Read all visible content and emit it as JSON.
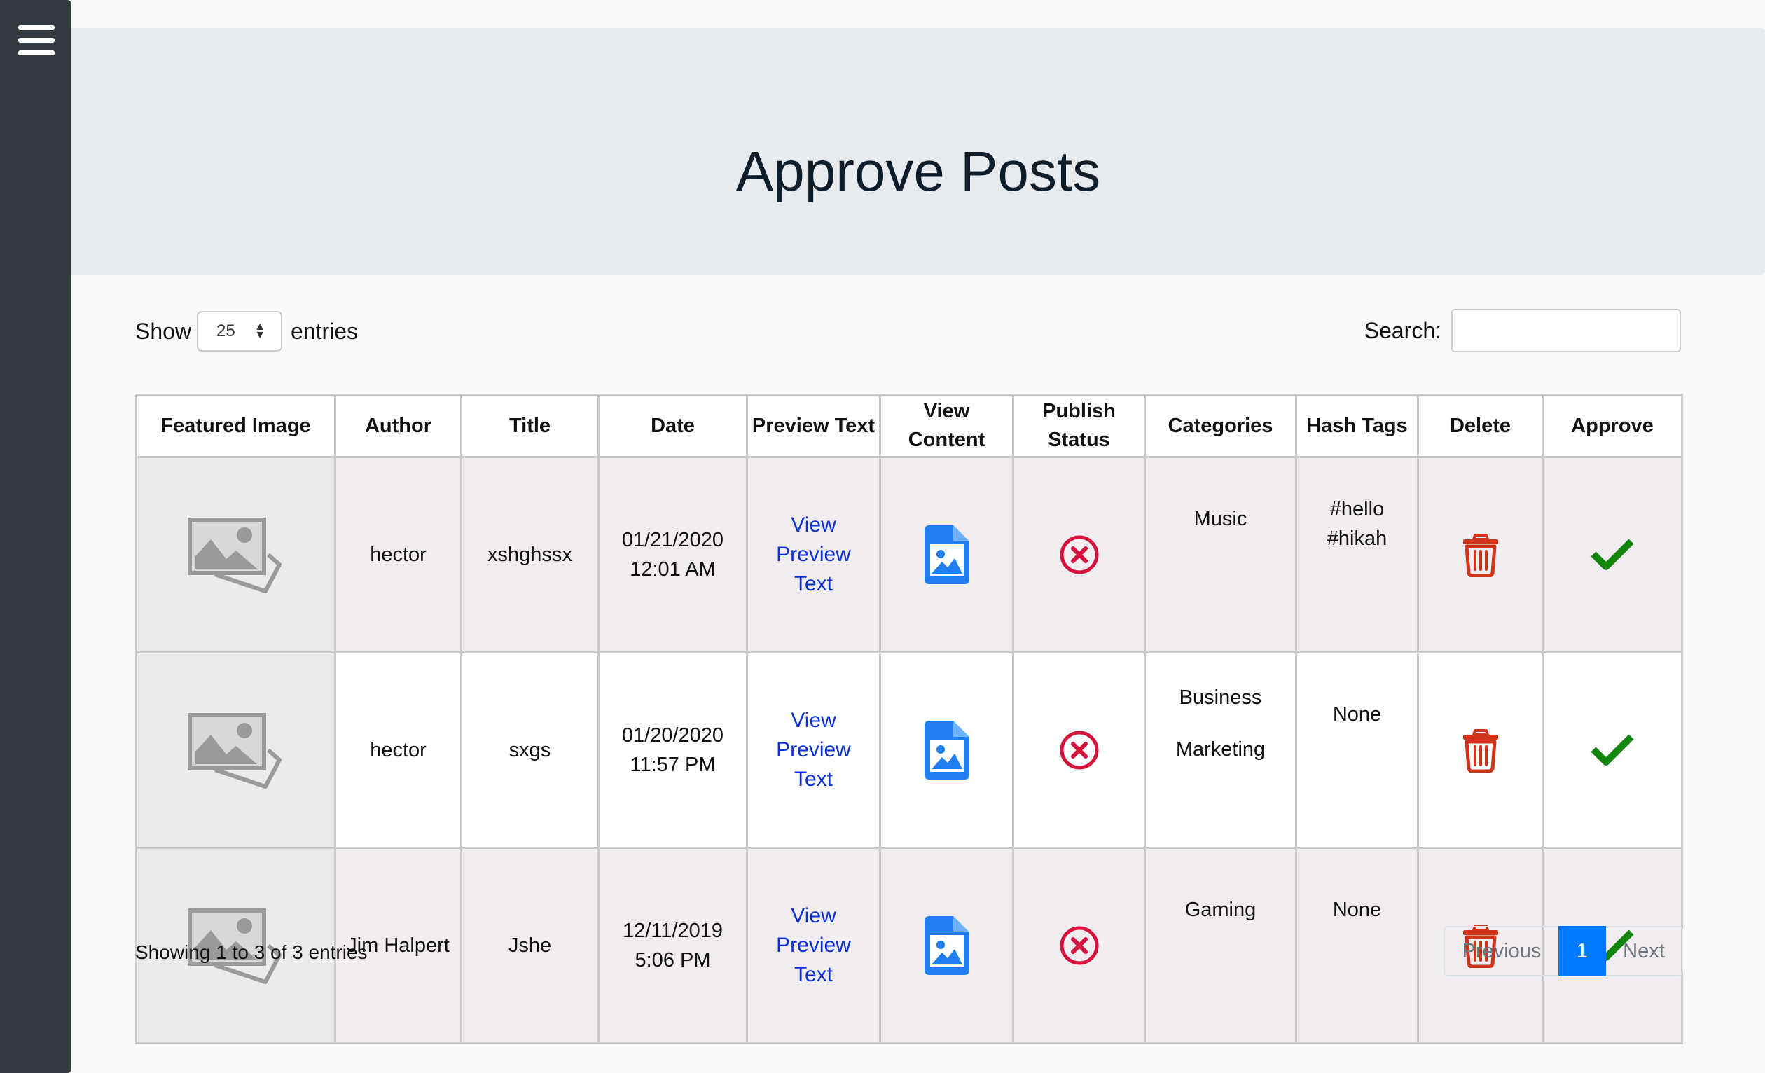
{
  "page": {
    "title": "Approve Posts"
  },
  "controls": {
    "show_label": "Show",
    "entries_label": "entries",
    "page_length": "25",
    "search_label": "Search:",
    "search_value": ""
  },
  "table": {
    "headers": {
      "featured_image": "Featured Image",
      "author": "Author",
      "title": "Title",
      "date": "Date",
      "preview_text": "Preview Text",
      "view_content": "View Content",
      "publish_status_1": "Publish",
      "publish_status_2": "Status",
      "categories": "Categories",
      "hash_tags": "Hash Tags",
      "delete": "Delete",
      "approve": "Approve"
    },
    "rows": [
      {
        "author": "hector",
        "title": "xshghssx",
        "date": "01/21/2020",
        "time": "12:01 AM",
        "preview_1": "View Preview",
        "preview_2": "Text",
        "categories": [
          "Music"
        ],
        "hashtags": [
          "#hello",
          "#hikah"
        ]
      },
      {
        "author": "hector",
        "title": "sxgs",
        "date": "01/20/2020",
        "time": "11:57 PM",
        "preview_1": "View Preview",
        "preview_2": "Text",
        "categories": [
          "Business",
          "Marketing"
        ],
        "hashtags": [
          "None"
        ]
      },
      {
        "author": "Jim Halpert",
        "title": "Jshe",
        "date": "12/11/2019",
        "time": "5:06 PM",
        "preview_1": "View Preview",
        "preview_2": "Text",
        "categories": [
          "Gaming"
        ],
        "hashtags": [
          "None"
        ]
      }
    ]
  },
  "footer": {
    "info": "Showing 1 to 3 of 3 entries",
    "pagination": {
      "previous": "Previous",
      "current": "1",
      "next": "Next"
    }
  },
  "icons": {
    "menu": "hamburger-menu-icon",
    "placeholder": "image-placeholder-icon",
    "content": "file-image-icon",
    "status": "x-circle-icon",
    "delete": "trash-icon",
    "approve": "checkmark-icon"
  },
  "colors": {
    "sidebar": "#343a40",
    "header_bg": "#e8ebee",
    "link": "#0b2fd9",
    "content_icon": "#1f7ff0",
    "status_icon": "#d5133d",
    "delete_icon": "#d0341a",
    "approve_icon": "#13850f",
    "page_active": "#007bff"
  }
}
